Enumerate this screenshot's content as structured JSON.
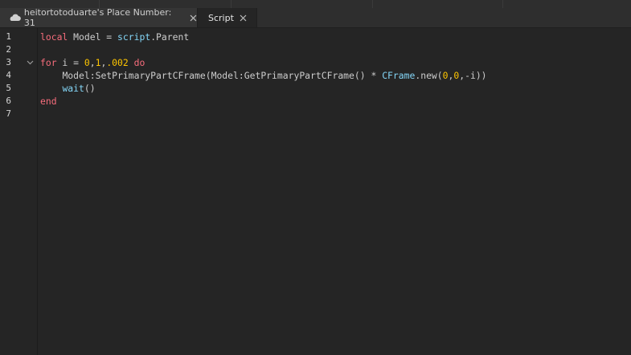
{
  "tabs": [
    {
      "label": "heitortotoduarte's Place Number: 31",
      "icon": "cloud-icon",
      "active": false
    },
    {
      "label": "Script",
      "active": true
    }
  ],
  "gutter": {
    "line_numbers": [
      "1",
      "2",
      "3",
      "4",
      "5",
      "6",
      "7"
    ]
  },
  "code": {
    "line1": {
      "kw_local": "local",
      "model": " Model = ",
      "script": "script",
      "parent": ".Parent"
    },
    "line3": {
      "kw_for": "for",
      "i_eq": " i = ",
      "n0": "0",
      "c1": ",",
      "n1": "1",
      "c2": ",",
      "n2": ".002",
      "sp": " ",
      "kw_do": "do"
    },
    "line4": {
      "indent": "    ",
      "call": "Model:SetPrimaryPartCFrame(Model:GetPrimaryPartCFrame() ",
      "star": "*",
      "sp": " ",
      "cframe": "CFrame",
      "dotnew": ".new(",
      "a": "0",
      "c1": ",",
      "b": "0",
      "c2": ",",
      "c": "-i",
      "close": "))"
    },
    "line5": {
      "indent": "    ",
      "wait": "wait",
      "parens": "()"
    },
    "line6": {
      "kw_end": "end"
    }
  },
  "colors": {
    "background": "#252525",
    "keyword": "#f86d7c",
    "builtin": "#84d6f7",
    "number": "#ffc600",
    "text": "#cccccc"
  }
}
